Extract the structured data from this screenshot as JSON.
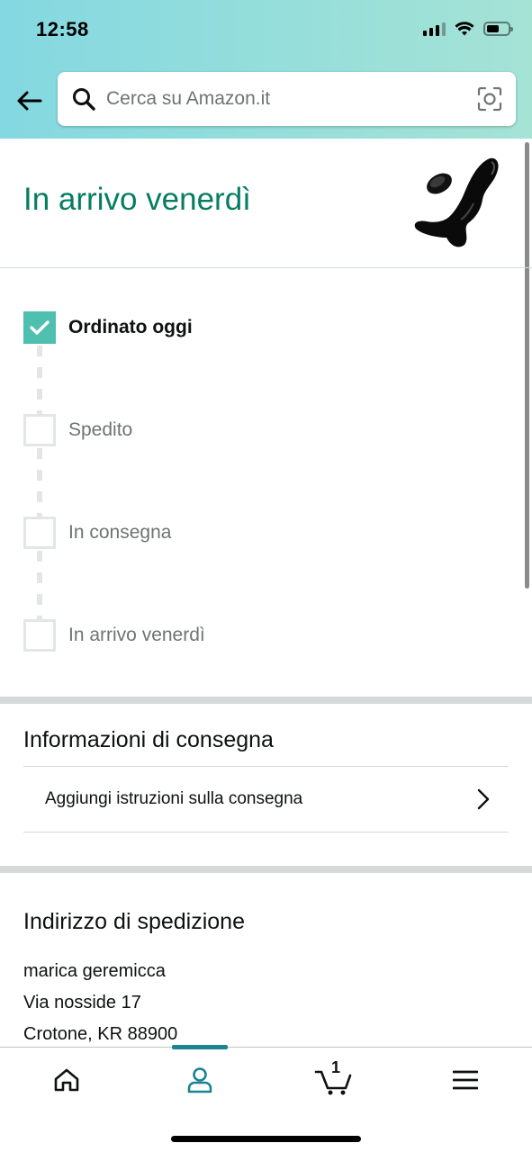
{
  "status_bar": {
    "time": "12:58"
  },
  "search": {
    "placeholder": "Cerca su Amazon.it"
  },
  "arrival": {
    "title": "In arrivo venerdì"
  },
  "tracker": {
    "steps": [
      {
        "label": "Ordinato oggi",
        "done": true
      },
      {
        "label": "Spedito",
        "done": false
      },
      {
        "label": "In consegna",
        "done": false
      },
      {
        "label": "In arrivo venerdì",
        "done": false
      }
    ]
  },
  "delivery_info": {
    "title": "Informazioni di consegna",
    "add_instructions": "Aggiungi istruzioni sulla consegna"
  },
  "shipping_address": {
    "title": "Indirizzo di spedizione",
    "name": "marica geremicca",
    "street": "Via nosside 17",
    "city": "Crotone, KR 88900"
  },
  "bottom_nav": {
    "cart_count": "1",
    "active": "account"
  },
  "colors": {
    "accent_green": "#067d62",
    "check_teal": "#4fbfb0",
    "nav_active": "#1b8392"
  }
}
